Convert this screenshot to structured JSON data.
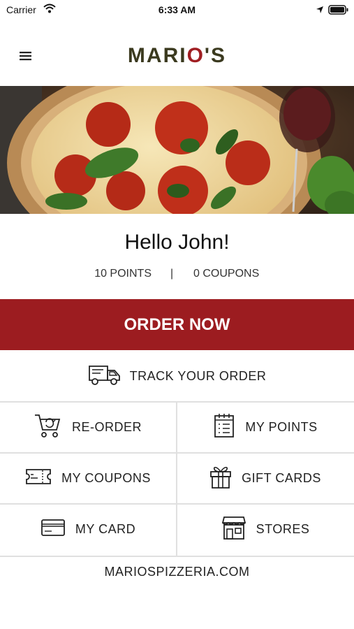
{
  "status_bar": {
    "carrier": "Carrier",
    "time": "6:33 AM"
  },
  "header": {
    "logo_text": "MARIO'S",
    "logo_pre": "MARI",
    "logo_o": "O",
    "logo_post": "'S",
    "menu_icon": "hamburger-icon"
  },
  "hero": {
    "image": "pizza-photo"
  },
  "greeting": "Hello John!",
  "stats": {
    "points": "10 POINTS",
    "separator": "|",
    "coupons": "0 COUPONS"
  },
  "order_now": "ORDER NOW",
  "track_order": {
    "label": "TRACK YOUR ORDER",
    "icon": "delivery-truck-icon"
  },
  "grid": [
    {
      "label": "RE-ORDER",
      "icon": "reorder-cart-icon"
    },
    {
      "label": "MY POINTS",
      "icon": "points-calendar-icon"
    },
    {
      "label": "MY COUPONS",
      "icon": "coupon-ticket-icon"
    },
    {
      "label": "GIFT CARDS",
      "icon": "gift-icon"
    },
    {
      "label": "MY CARD",
      "icon": "credit-card-icon"
    },
    {
      "label": "STORES",
      "icon": "store-icon"
    }
  ],
  "website": "MARIOSPIZZERIA.COM",
  "colors": {
    "brand_red": "#9c1c20",
    "logo_olive": "#3b3a1f"
  }
}
